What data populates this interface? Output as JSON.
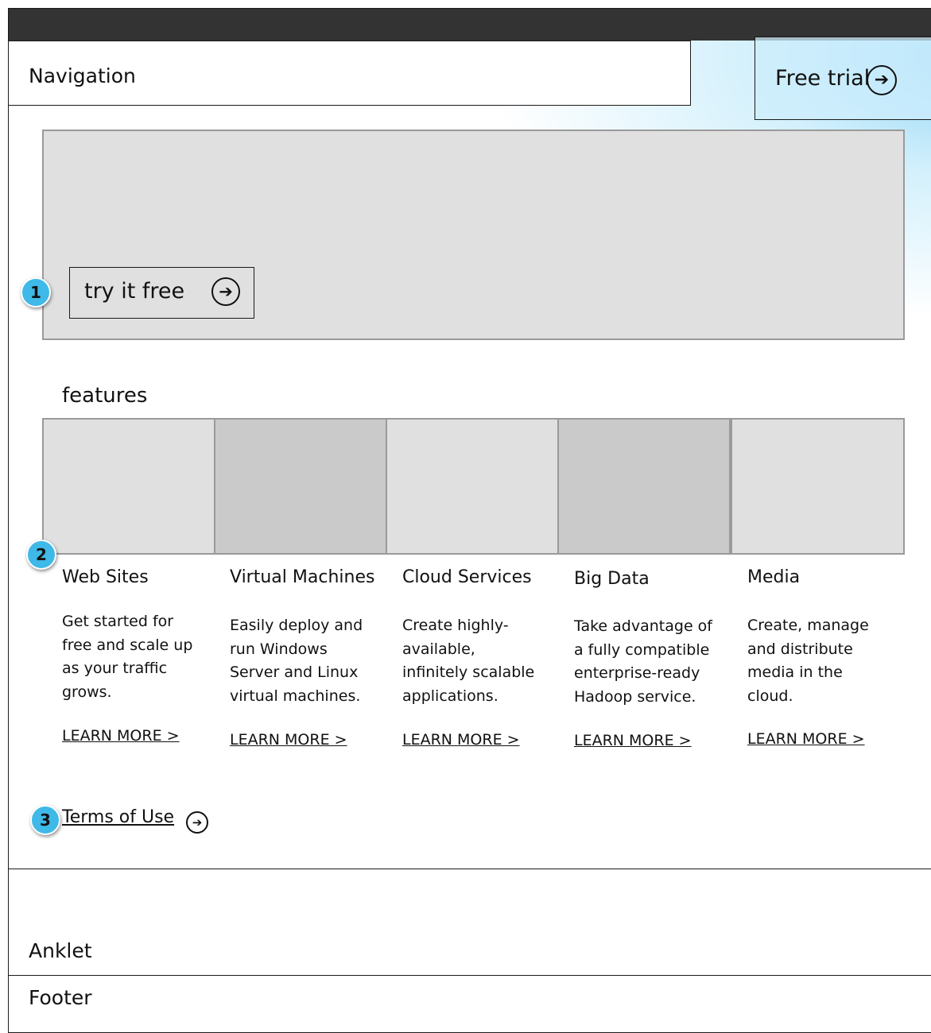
{
  "nav": {
    "label": "Navigation"
  },
  "free_trial": {
    "label": "Free trial",
    "icon": "arrow-right-circle-icon"
  },
  "hero": {
    "button_label": "try it free",
    "icon": "arrow-right-circle-icon"
  },
  "callouts": [
    "1",
    "2",
    "3"
  ],
  "features": {
    "heading": "features",
    "items": [
      {
        "title": "Web Sites",
        "desc_lines": [
          "Get started for",
          "free and scale up",
          "as your traffic",
          "grows."
        ],
        "link": "LEARN MORE >"
      },
      {
        "title": "Virtual Machines",
        "desc_lines": [
          "Easily deploy and",
          "run Windows",
          "Server and Linux",
          "virtual machines."
        ],
        "link": "LEARN MORE >"
      },
      {
        "title": "Cloud Services",
        "desc_lines": [
          "Create highly-",
          "available,",
          "infinitely scalable",
          "applications."
        ],
        "link": "LEARN MORE >"
      },
      {
        "title": "Big Data",
        "desc_lines": [
          "Take advantage of",
          "a fully compatible",
          "enterprise-ready",
          "Hadoop service."
        ],
        "link": "LEARN MORE >"
      },
      {
        "title": "Media",
        "desc_lines": [
          "Create, manage",
          "and distribute",
          "media in the",
          "cloud."
        ],
        "link": "LEARN MORE >"
      }
    ]
  },
  "terms": {
    "label": "Terms of Use",
    "icon": "arrow-right-circle-icon"
  },
  "anklet": {
    "label": "Anklet"
  },
  "footer": {
    "label": "Footer"
  },
  "colors": {
    "topbar": "#333333",
    "placeholder_light": "#e0e0e0",
    "placeholder_dark": "#cacaca",
    "callout_badge": "#3fb9e8",
    "trial_glow": "#87d2f5"
  }
}
